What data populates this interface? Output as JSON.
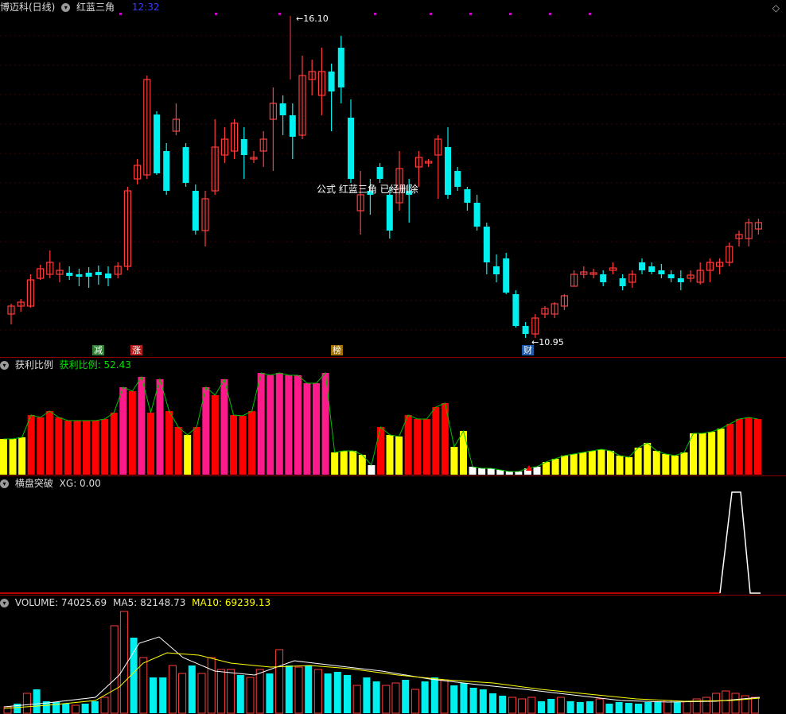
{
  "header": {
    "stock_title": "博迈科(日线)",
    "formula_name": "红蓝三角",
    "time": "12:32"
  },
  "main_chart": {
    "high_label": "16.10",
    "low_label": "10.95",
    "formula_notice": "公式 红蓝三角 已经删除",
    "tags": [
      {
        "text": "减",
        "color": "#2e7d32"
      },
      {
        "text": "涨",
        "color": "#b71c1c"
      },
      {
        "text": "榜",
        "color": "#a07000"
      },
      {
        "text": "财",
        "color": "#1e5aa8"
      }
    ]
  },
  "profit_panel": {
    "name": "获利比例",
    "value_label": "获利比例: 52.43"
  },
  "breakout_panel": {
    "name": "横盘突破",
    "value_label": "XG: 0.00"
  },
  "volume_panel": {
    "volume_label": "VOLUME: 74025.69",
    "ma5_label": "MA5: 82148.73",
    "ma10_label": "MA10: 69239.13"
  },
  "colors": {
    "up": "#ff3c3c",
    "down": "#00f0f0",
    "profit_low": "#ffff00",
    "profit_mid": "#ff0000",
    "profit_high": "#ff1a8c",
    "ma5": "#ffffff",
    "ma10": "#ffff00",
    "separator": "#8b0000"
  }
}
